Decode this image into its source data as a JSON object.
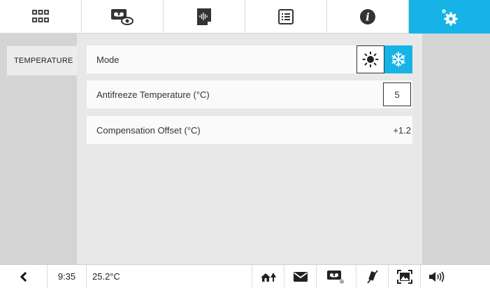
{
  "tabs": [
    {
      "icon": "grid-icon",
      "active": false
    },
    {
      "icon": "video-watch-icon",
      "active": false
    },
    {
      "icon": "audio-file-icon",
      "active": false
    },
    {
      "icon": "list-icon",
      "active": false
    },
    {
      "icon": "info-icon",
      "active": false
    },
    {
      "icon": "settings-gear-icon",
      "active": true
    }
  ],
  "sidebar": {
    "items": [
      {
        "label": "TEMPERATURE"
      }
    ]
  },
  "settings": {
    "mode": {
      "label": "Mode",
      "selected": "winter"
    },
    "antifreeze": {
      "label": "Antifreeze Temperature (°C)",
      "value": "5"
    },
    "offset": {
      "label": "Compensation Offset (°C)",
      "value": "+1.2"
    }
  },
  "statusbar": {
    "time": "9:35",
    "temperature": "25.2°C",
    "icons": [
      "back-arrow-icon",
      "home-tree-icon",
      "mail-icon",
      "voicemail-icon",
      "mute-icon",
      "frame-capture-icon",
      "volume-icon"
    ]
  },
  "colors": {
    "accent": "#16b4e6",
    "sidebar": "#d4d4d4",
    "content": "#e8e8e8"
  }
}
